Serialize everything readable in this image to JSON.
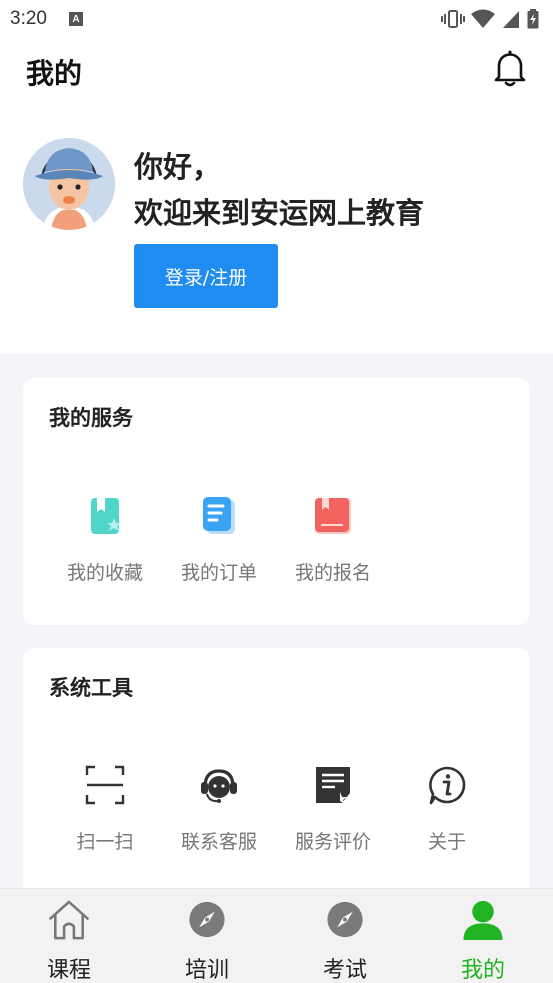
{
  "status_bar": {
    "time": "3:20",
    "notification_icon": "A"
  },
  "header": {
    "title": "我的"
  },
  "profile": {
    "greeting_line1": "你好，",
    "greeting_line2": "欢迎来到安运网上教育",
    "login_button": "登录/注册"
  },
  "services": {
    "title": "我的服务",
    "items": [
      {
        "label": "我的收藏",
        "icon": "bookmark-star-icon",
        "color": "#4fd6c8"
      },
      {
        "label": "我的订单",
        "icon": "order-document-icon",
        "color": "#3aa3f5"
      },
      {
        "label": "我的报名",
        "icon": "registration-book-icon",
        "color": "#f2625e"
      }
    ]
  },
  "tools": {
    "title": "系统工具",
    "items": [
      {
        "label": "扫一扫",
        "icon": "scan-icon"
      },
      {
        "label": "联系客服",
        "icon": "customer-service-headset-icon"
      },
      {
        "label": "服务评价",
        "icon": "service-review-icon"
      },
      {
        "label": "关于",
        "icon": "info-icon"
      }
    ]
  },
  "tab_bar": {
    "tabs": [
      {
        "label": "课程",
        "icon": "home-icon",
        "active": false
      },
      {
        "label": "培训",
        "icon": "compass-icon",
        "active": false
      },
      {
        "label": "考试",
        "icon": "compass-icon",
        "active": false
      },
      {
        "label": "我的",
        "icon": "user-icon",
        "active": true
      }
    ],
    "active_color": "#21b321"
  },
  "colors": {
    "primary_button": "#1f8cf2",
    "page_background": "#f4f5f8"
  }
}
